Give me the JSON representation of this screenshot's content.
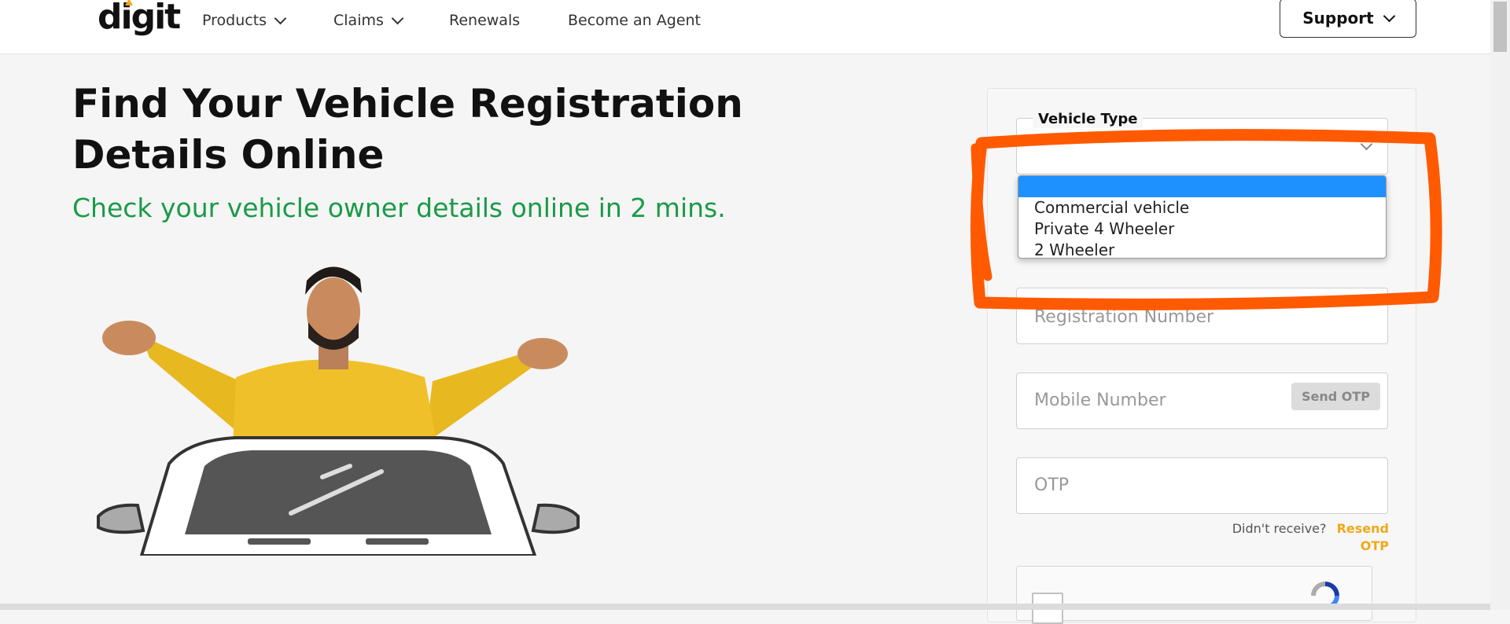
{
  "header": {
    "logo_text": "digit",
    "nav": {
      "products": "Products",
      "claims": "Claims",
      "renewals": "Renewals",
      "become_agent": "Become an Agent"
    },
    "support": "Support"
  },
  "hero": {
    "title": "Find Your Vehicle Registration Details Online",
    "subtitle": "Check your vehicle owner details online in 2 mins."
  },
  "form": {
    "vehicle_type_label": "Vehicle Type",
    "vehicle_type_value": "",
    "vehicle_type_options": [
      "",
      "Commercial vehicle",
      "Private 4 Wheeler",
      "2 Wheeler"
    ],
    "registration_placeholder": "Registration Number",
    "mobile_placeholder": "Mobile Number",
    "send_otp": "Send OTP",
    "otp_placeholder": "OTP",
    "didnt_receive": "Didn't receive?",
    "resend_otp": "Resend OTP"
  },
  "colors": {
    "accent_green": "#1a9a48",
    "accent_orange": "#f0a81a",
    "annotation_orange": "#ff5a00",
    "dropdown_highlight": "#1e90ff"
  }
}
